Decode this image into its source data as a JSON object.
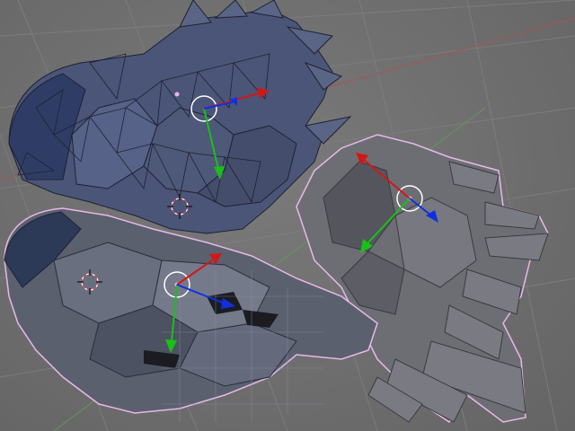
{
  "viewport": {
    "kind": "3d-viewport",
    "background_color": "#6f6f6f",
    "grid_color": "#7d7d7d",
    "axis_x_color": "#b05050",
    "axis_y_color": "#5aa05a",
    "selection_outline_color": "#e8b8e8"
  },
  "objects": [
    {
      "name": "mesh-object-wire-upper",
      "selected": false,
      "shading": "wireframe-on-solid",
      "color": "#4a5676"
    },
    {
      "name": "mesh-object-lower-left",
      "selected": true,
      "shading": "solid",
      "color": "#585d6e"
    },
    {
      "name": "mesh-object-right-fan",
      "selected": true,
      "shading": "solid",
      "color": "#6c6c72"
    }
  ],
  "manipulators": [
    {
      "name": "translate-manipulator-upper",
      "colors": {
        "x": "#d01818",
        "y": "#18c018",
        "z": "#1030e0"
      }
    },
    {
      "name": "translate-manipulator-lower",
      "colors": {
        "x": "#d01818",
        "y": "#18c018",
        "z": "#1030e0"
      }
    },
    {
      "name": "translate-manipulator-right",
      "colors": {
        "x": "#d01818",
        "y": "#18c018",
        "z": "#1030e0"
      }
    }
  ],
  "cursors": [
    {
      "name": "3d-cursor-upper"
    },
    {
      "name": "3d-cursor-lower"
    }
  ]
}
